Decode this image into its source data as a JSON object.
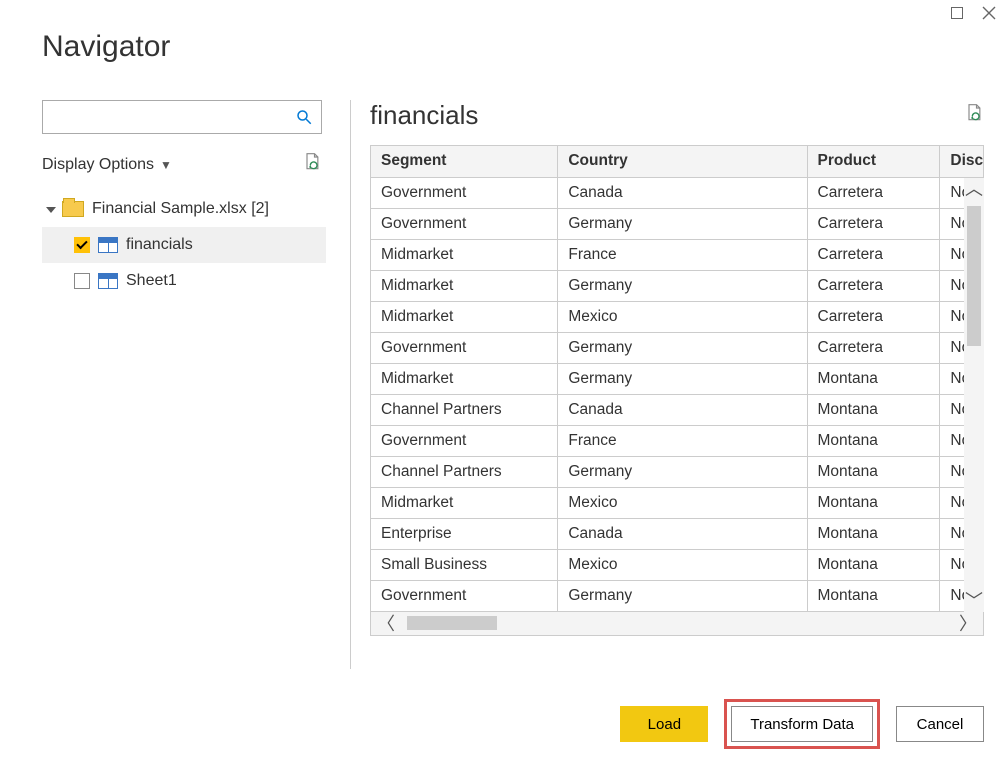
{
  "window": {
    "title": "Navigator"
  },
  "search": {
    "value": ""
  },
  "display_options_label": "Display Options",
  "tree": {
    "root": {
      "label": "Financial Sample.xlsx",
      "count_suffix": "[2]"
    },
    "items": [
      {
        "label": "financials",
        "checked": true,
        "selected": true
      },
      {
        "label": "Sheet1",
        "checked": false,
        "selected": false
      }
    ]
  },
  "preview": {
    "title": "financials",
    "columns": [
      "Segment",
      "Country",
      "Product",
      "Discou"
    ],
    "rows": [
      [
        "Government",
        "Canada",
        "Carretera",
        "No"
      ],
      [
        "Government",
        "Germany",
        "Carretera",
        "No"
      ],
      [
        "Midmarket",
        "France",
        "Carretera",
        "No"
      ],
      [
        "Midmarket",
        "Germany",
        "Carretera",
        "No"
      ],
      [
        "Midmarket",
        "Mexico",
        "Carretera",
        "No"
      ],
      [
        "Government",
        "Germany",
        "Carretera",
        "No"
      ],
      [
        "Midmarket",
        "Germany",
        "Montana",
        "No"
      ],
      [
        "Channel Partners",
        "Canada",
        "Montana",
        "No"
      ],
      [
        "Government",
        "France",
        "Montana",
        "No"
      ],
      [
        "Channel Partners",
        "Germany",
        "Montana",
        "No"
      ],
      [
        "Midmarket",
        "Mexico",
        "Montana",
        "No"
      ],
      [
        "Enterprise",
        "Canada",
        "Montana",
        "No"
      ],
      [
        "Small Business",
        "Mexico",
        "Montana",
        "No"
      ],
      [
        "Government",
        "Germany",
        "Montana",
        "No"
      ]
    ]
  },
  "buttons": {
    "load": "Load",
    "transform": "Transform Data",
    "cancel": "Cancel"
  }
}
